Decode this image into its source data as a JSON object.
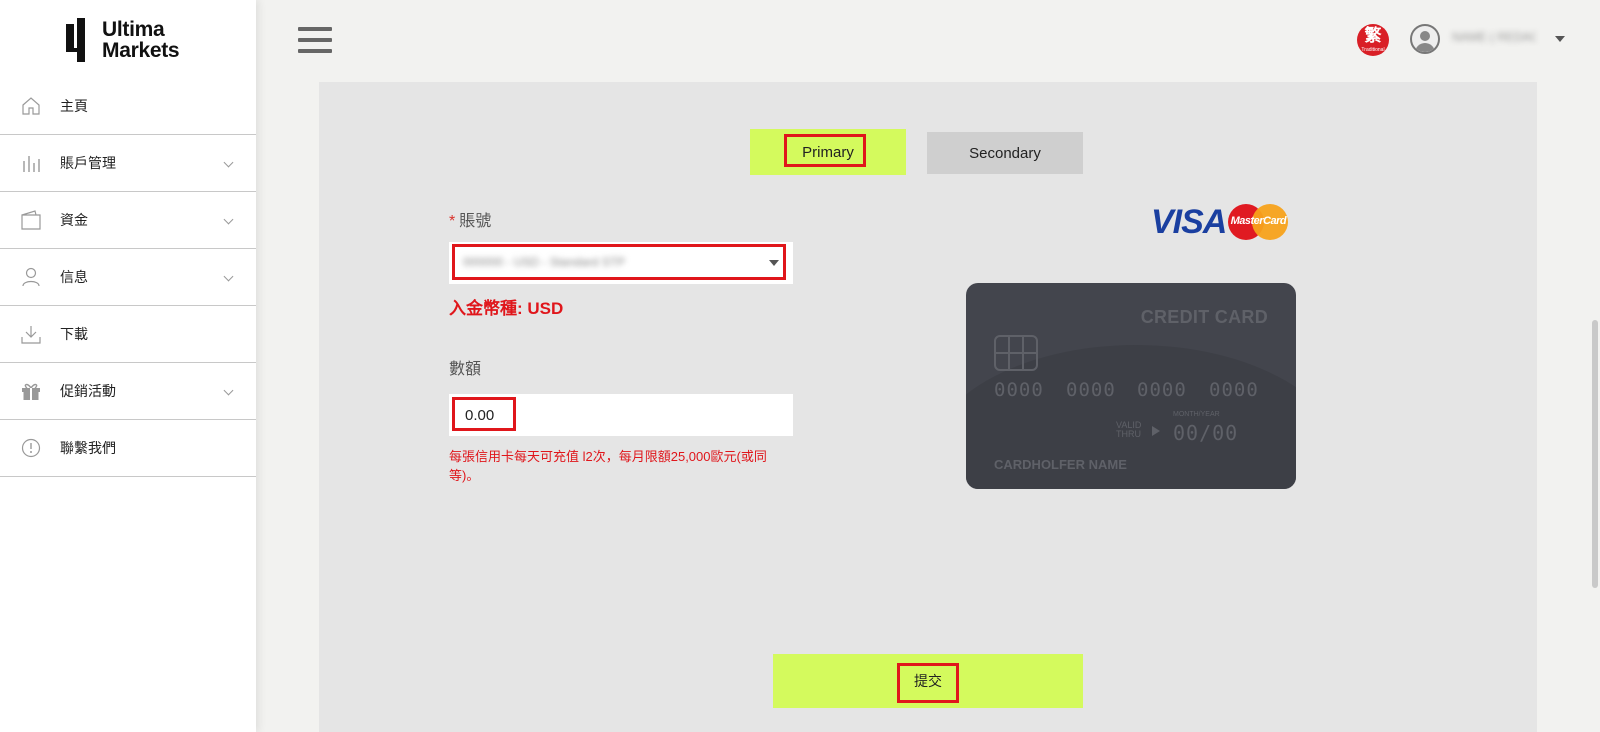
{
  "brand": {
    "name_line1": "Ultima",
    "name_line2": "Markets"
  },
  "sidebar": {
    "items": [
      {
        "label": "主頁",
        "icon": "home-icon",
        "has_submenu": false
      },
      {
        "label": "賬戶管理",
        "icon": "bars-icon",
        "has_submenu": true
      },
      {
        "label": "資金",
        "icon": "wallet-icon",
        "has_submenu": true
      },
      {
        "label": "信息",
        "icon": "user-icon",
        "has_submenu": true
      },
      {
        "label": "下載",
        "icon": "download-icon",
        "has_submenu": false
      },
      {
        "label": "促銷活動",
        "icon": "gift-icon",
        "has_submenu": true
      },
      {
        "label": "聯繫我們",
        "icon": "info-icon",
        "has_submenu": false
      }
    ]
  },
  "header": {
    "language": {
      "char": "繁",
      "sub": "Traditional"
    },
    "user_name": "NAME ( REDACTED )"
  },
  "tabs": {
    "primary": "Primary",
    "secondary": "Secondary",
    "active": "Primary"
  },
  "form": {
    "account_label": "賬號",
    "account_required_mark": "*",
    "account_value": "000000 - USD - Standard STP",
    "currency_text": "入金幣種: USD",
    "amount_label": "數額",
    "amount_value": "0.00",
    "limit_note": "每張信用卡每天可充值 l2次，每月限額25,000歐元(或同等)。",
    "submit_label": "提交"
  },
  "card": {
    "visa_text": "VISA",
    "mastercard_text": "MasterCard",
    "title": "CREDIT CARD",
    "number_groups": [
      "0000",
      "0000",
      "0000",
      "0000"
    ],
    "valid_thru": "VALID THRU",
    "month_year": "MONTH/YEAR",
    "expiry": "00/00",
    "holder": "CARDHOLFER NAME"
  },
  "colors": {
    "accent": "#d4fa5d",
    "highlight": "#e0161b",
    "error_text": "#e0161b",
    "card_bg": "#43454d"
  }
}
